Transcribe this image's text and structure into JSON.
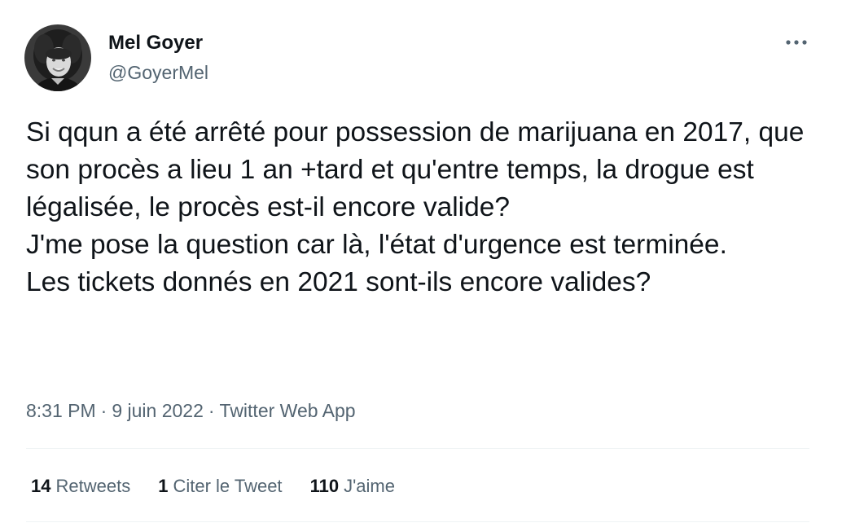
{
  "author": {
    "display_name": "Mel Goyer",
    "handle": "@GoyerMel"
  },
  "tweet": {
    "text": "Si qqun a été arrêté pour possession de marijuana en 2017, que son procès a lieu 1 an +tard et qu'entre temps, la drogue est légalisée, le procès est-il encore valide?\nJ'me pose la question car là, l'état d'urgence est terminée.\nLes tickets donnés en 2021 sont-ils encore valides?",
    "time": "8:31 PM",
    "date": "9 juin 2022",
    "separator": "·",
    "source": "Twitter Web App"
  },
  "stats": {
    "retweets_count": "14",
    "retweets_label": "Retweets",
    "quotes_count": "1",
    "quotes_label": "Citer le Tweet",
    "likes_count": "110",
    "likes_label": "J'aime"
  },
  "icons": {
    "more": "more-horizontal-icon",
    "avatar": "avatar-photo"
  },
  "colors": {
    "text_primary": "#0f1419",
    "text_secondary": "#536471",
    "divider": "#eff3f4",
    "background": "#ffffff"
  }
}
